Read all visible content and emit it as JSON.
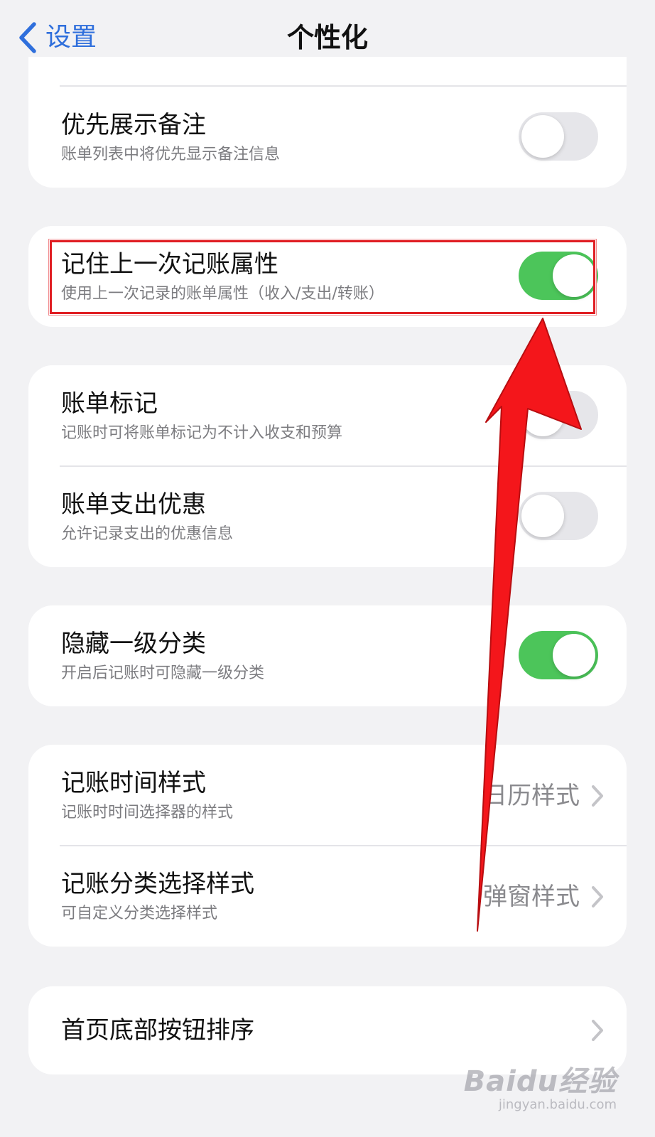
{
  "nav": {
    "back_label": "设置",
    "title": "个性化"
  },
  "settings": {
    "priority_note": {
      "title": "优先展示备注",
      "subtitle": "账单列表中将优先显示备注信息",
      "enabled": false
    },
    "remember_last": {
      "title": "记住上一次记账属性",
      "subtitle": "使用上一次记录的账单属性（收入/支出/转账）",
      "enabled": true
    },
    "bill_mark": {
      "title": "账单标记",
      "subtitle": "记账时可将账单标记为不计入收支和预算",
      "enabled": false
    },
    "expense_discount": {
      "title": "账单支出优惠",
      "subtitle": "允许记录支出的优惠信息",
      "enabled": false
    },
    "hide_level1": {
      "title": "隐藏一级分类",
      "subtitle": "开启后记账时可隐藏一级分类",
      "enabled": true
    },
    "time_style": {
      "title": "记账时间样式",
      "subtitle": "记账时时间选择器的样式",
      "value": "日历样式"
    },
    "category_style": {
      "title": "记账分类选择样式",
      "subtitle": "可自定义分类选择样式",
      "value": "弹窗样式"
    },
    "home_buttons": {
      "title": "首页底部按钮排序"
    }
  },
  "colors": {
    "accent_blue": "#2f6fdc",
    "toggle_on": "#4cc55a",
    "toggle_off": "#e6e6ea",
    "annotation_red": "#e01e23"
  },
  "watermark": {
    "logo": "Baidu经验",
    "url": "jingyan.baidu.com"
  }
}
